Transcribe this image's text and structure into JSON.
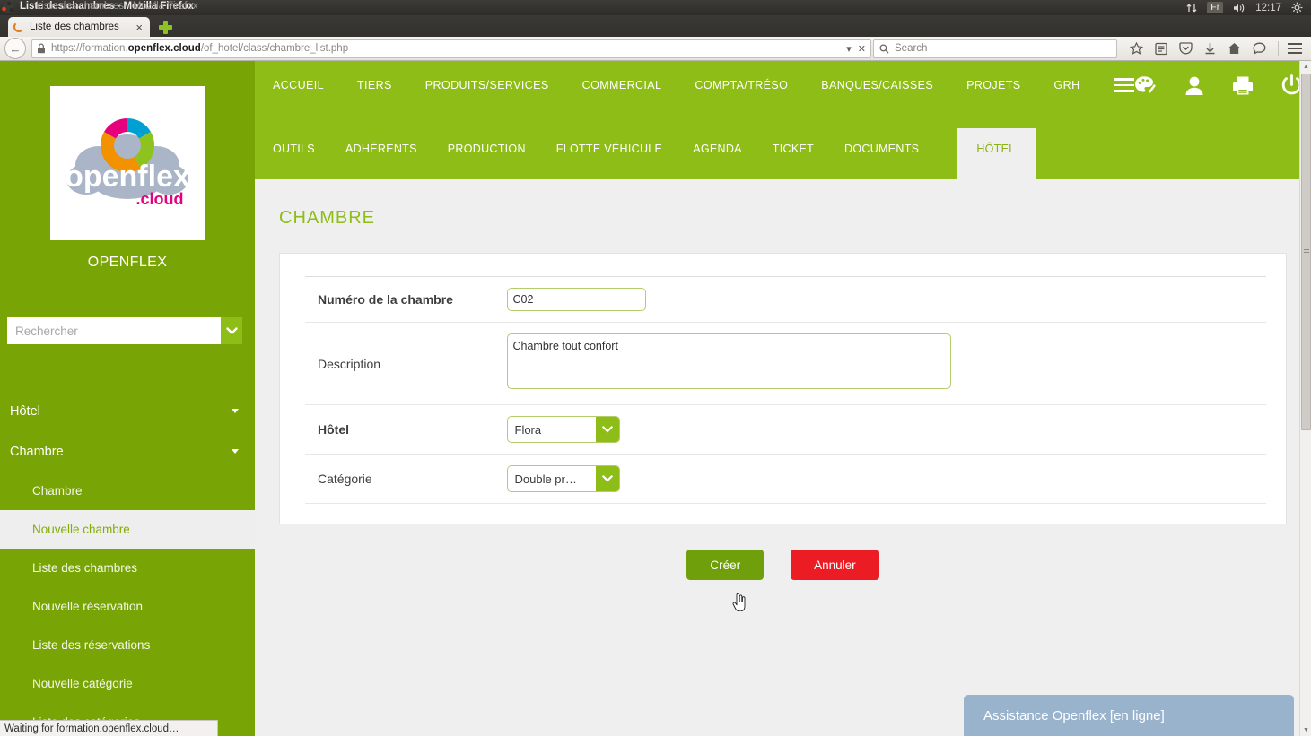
{
  "os": {
    "window_title_front": "Liste des chambres - Mozilla Firefox",
    "window_title_back": "Liste des chambres - Mozilla Firefox",
    "tray": {
      "keyboard": "Fr",
      "clock": "12:17"
    }
  },
  "browser": {
    "tab": {
      "label": "Liste des chambres",
      "close": "×"
    },
    "url": {
      "scheme": "https://formation.",
      "domain": "openflex.cloud",
      "path": "/of_hotel/class/chambre_list.php"
    },
    "search_placeholder": "Search",
    "status_text": "Waiting for formation.openflex.cloud…"
  },
  "sidebar": {
    "brand": "OPENFLEX",
    "logo_word": "openflex",
    "logo_suffix": ".cloud",
    "search_placeholder": "Rechercher",
    "groups": [
      {
        "label": "Hôtel"
      },
      {
        "label": "Chambre"
      }
    ],
    "items": [
      {
        "label": "Chambre",
        "active": false
      },
      {
        "label": "Nouvelle chambre",
        "active": true
      },
      {
        "label": "Liste des chambres",
        "active": false
      },
      {
        "label": "Nouvelle réservation",
        "active": false
      },
      {
        "label": "Liste des réservations",
        "active": false
      },
      {
        "label": "Nouvelle catégorie",
        "active": false
      },
      {
        "label": "Liste des catégories",
        "active": false
      }
    ]
  },
  "topnav": {
    "row1": [
      "ACCUEIL",
      "TIERS",
      "PRODUITS/SERVICES",
      "COMMERCIAL",
      "COMPTA/TRÉSO",
      "BANQUES/CAISSES",
      "PROJETS",
      "GRH"
    ],
    "row2": [
      "OUTILS",
      "ADHÉRENTS",
      "PRODUCTION",
      "FLOTTE VÉHICULE",
      "AGENDA",
      "TICKET",
      "DOCUMENTS"
    ],
    "active_tab": "HÔTEL"
  },
  "main": {
    "title": "CHAMBRE",
    "fields": {
      "numero_label": "Numéro de la chambre",
      "numero_value": "C02",
      "description_label": "Description",
      "description_value": "Chambre tout confort",
      "hotel_label": "Hôtel",
      "hotel_value": "Flora",
      "categorie_label": "Catégorie",
      "categorie_value": "Double pr…"
    },
    "buttons": {
      "create": "Créer",
      "cancel": "Annuler"
    }
  },
  "chat": {
    "label": "Assistance Openflex [en ligne]"
  },
  "colors": {
    "brand_green": "#8ebd18",
    "sidebar_green": "#78a405",
    "create_green": "#6f9f0a",
    "cancel_red": "#ec1c24",
    "chat_blue": "#9ab3cd",
    "field_border": "#b5cc6d"
  }
}
